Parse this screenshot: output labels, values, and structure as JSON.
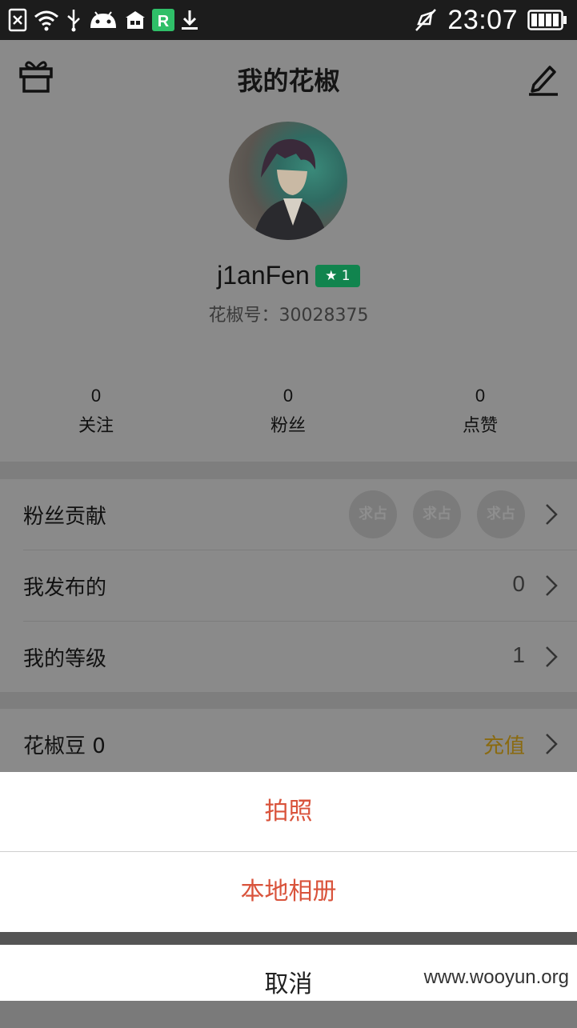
{
  "status_bar": {
    "time": "23:07",
    "icons": [
      "sim-error-icon",
      "wifi-icon",
      "usb-icon",
      "android-debug-icon",
      "store-icon",
      "r-app-icon",
      "download-icon",
      "mute-icon",
      "battery-icon"
    ]
  },
  "header": {
    "title": "我的花椒",
    "gift_icon": "gift-icon",
    "edit_icon": "edit-icon"
  },
  "profile": {
    "username": "j1anFen",
    "level_badge": "★ 1",
    "id_text": "花椒号：30028375"
  },
  "stats": [
    {
      "value": "0",
      "label": "关注"
    },
    {
      "value": "0",
      "label": "粉丝"
    },
    {
      "value": "0",
      "label": "点赞"
    }
  ],
  "rows": {
    "fan_contribution": {
      "label": "粉丝贡献",
      "slots": [
        "求占",
        "求占",
        "求占"
      ]
    },
    "published": {
      "label": "我发布的",
      "value": "0"
    },
    "level": {
      "label": "我的等级",
      "value": "1"
    },
    "beans": {
      "label": "花椒豆 0",
      "action": "充值"
    }
  },
  "action_sheet": {
    "take_photo": "拍照",
    "local_album": "本地相册",
    "cancel": "取消"
  },
  "watermark": "www.wooyun.org",
  "colors": {
    "accent_red": "#d9533b",
    "badge_green": "#11844e",
    "recharge_gold": "#8a6a10"
  }
}
